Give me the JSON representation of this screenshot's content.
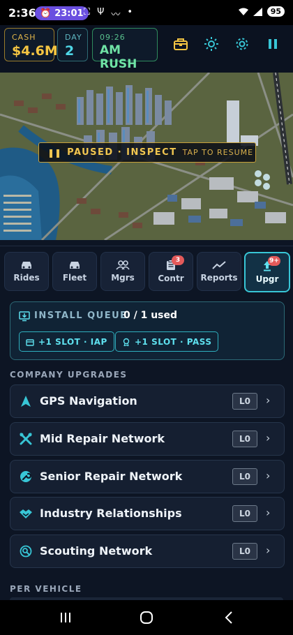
{
  "status_bar": {
    "time": "2:36",
    "alarm": "23:01",
    "battery": "95"
  },
  "hud": {
    "cash_label": "CASH",
    "cash_value": "$4.6M",
    "day_label": "DAY",
    "day_value": "2",
    "clock": "09:26",
    "phase": "AM RUSH",
    "icons": [
      "treasure-chest-icon",
      "brightness-icon",
      "gear-icon",
      "pause-icon"
    ]
  },
  "map": {
    "banner_main": "PAUSED · INSPECT",
    "banner_hint": "TAP TO RESUME"
  },
  "tabs": [
    {
      "label": "Rides",
      "icon": "car-icon",
      "badge": ""
    },
    {
      "label": "Fleet",
      "icon": "car-icon",
      "badge": ""
    },
    {
      "label": "Mgrs",
      "icon": "people-icon",
      "badge": ""
    },
    {
      "label": "Contr",
      "icon": "clipboard-icon",
      "badge": "3"
    },
    {
      "label": "Reports",
      "icon": "trend-icon",
      "badge": ""
    },
    {
      "label": "Upgr",
      "icon": "upgrade-icon",
      "badge": "9+",
      "active": true
    }
  ],
  "install_queue": {
    "title": "INSTALL QUEUE",
    "used": "0 / 1 used",
    "btn_iap": "+1 SLOT · IAP",
    "btn_pass": "+1 SLOT · PASS"
  },
  "company_upgrades": {
    "heading": "COMPANY UPGRADES",
    "items": [
      {
        "name": "GPS Navigation",
        "level": "L0",
        "icon": "navigation-arrow-icon"
      },
      {
        "name": "Mid Repair Network",
        "level": "L0",
        "icon": "tools-icon"
      },
      {
        "name": "Senior Repair Network",
        "level": "L0",
        "icon": "wrench-icon"
      },
      {
        "name": "Industry Relationships",
        "level": "L0",
        "icon": "handshake-icon"
      },
      {
        "name": "Scouting Network",
        "level": "L0",
        "icon": "scouting-icon"
      }
    ]
  },
  "per_vehicle": {
    "heading": "PER VEHICLE"
  },
  "colors": {
    "accent_cyan": "#38c6d6",
    "cash_gold": "#f4c542",
    "time_green": "#6fe3a5",
    "badge_red": "#e35a5a"
  }
}
